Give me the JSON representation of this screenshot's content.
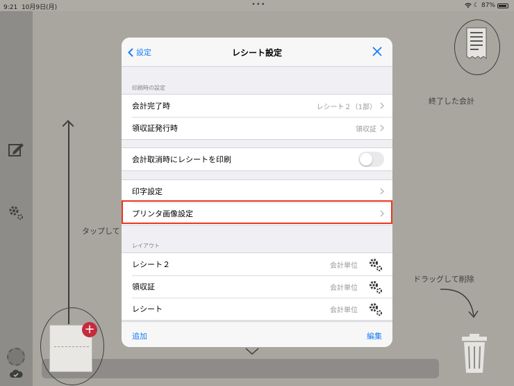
{
  "status_bar": {
    "time": "9:21",
    "date": "10月9日(月)",
    "battery": "87%"
  },
  "background": {
    "tap_hint": "タップして",
    "finished_label": "終了した会計",
    "drag_label": "ドラッグして削除"
  },
  "modal": {
    "back_label": "設定",
    "title": "レシート設定",
    "print_timing": {
      "header": "印刷時の設定",
      "rows": [
        {
          "label": "会計完了時",
          "value": "レシート２（1部）"
        },
        {
          "label": "領収証発行時",
          "value": "領収証"
        }
      ]
    },
    "cancel_print": {
      "label": "会計取消時にレシートを印刷",
      "enabled": false
    },
    "settings": {
      "rows": [
        {
          "label": "印字設定"
        },
        {
          "label": "プリンタ画像設定"
        }
      ]
    },
    "layout": {
      "header": "レイアウト",
      "rows": [
        {
          "label": "レシート２",
          "value": "会計単位"
        },
        {
          "label": "領収証",
          "value": "会計単位"
        },
        {
          "label": "レシート",
          "value": "会計単位"
        }
      ]
    },
    "add_label": "追加",
    "edit_label": "編集"
  },
  "colors": {
    "accent": "#1a7cf5",
    "highlight": "#e8361d",
    "badge": "#c62b3b"
  }
}
